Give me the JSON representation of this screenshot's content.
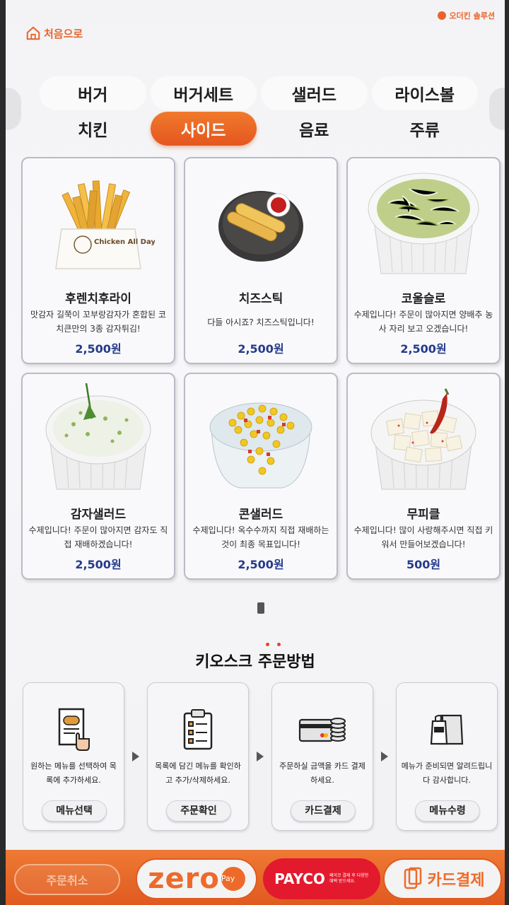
{
  "header": {
    "home_label": "처음으로",
    "brand": "오더킨 솔루션"
  },
  "categories": [
    {
      "label": "버거",
      "active": false
    },
    {
      "label": "버거세트",
      "active": false
    },
    {
      "label": "샐러드",
      "active": false
    },
    {
      "label": "라이스볼",
      "active": false
    },
    {
      "label": "치킨",
      "active": false
    },
    {
      "label": "사이드",
      "active": true
    },
    {
      "label": "음료",
      "active": false
    },
    {
      "label": "주류",
      "active": false
    }
  ],
  "menu": [
    {
      "name": "후렌치후라이",
      "desc": "맛감자 길쭉이 꼬부랑감자가 혼합된 코치큰만의 3종 감자튀김!",
      "price": "2,500원",
      "pic": "fries"
    },
    {
      "name": "치즈스틱",
      "desc": "다들 아시죠? 치즈스틱입니다!",
      "price": "2,500원",
      "pic": "cheese-stick"
    },
    {
      "name": "코울슬로",
      "desc": "수제입니다! 주문이 많아지면 양배추 농사 자리 보고 오겠습니다!",
      "price": "2,500원",
      "pic": "coleslaw"
    },
    {
      "name": "감자샐러드",
      "desc": "수제입니다! 주문이 많아지면 감자도 직접 재배하겠습니다!",
      "price": "2,500원",
      "pic": "potato-salad"
    },
    {
      "name": "콘샐러드",
      "desc": "수제입니다! 옥수수까지 직접 재배하는 것이 최종 목표입니다!",
      "price": "2,500원",
      "pic": "corn-salad"
    },
    {
      "name": "무피클",
      "desc": "수제입니다! 많이 사랑해주시면 직접 키워서 만들어보겠습니다!",
      "price": "500원",
      "pic": "radish-pickle"
    }
  ],
  "fries_bag_text": "Chicken All Day!",
  "guide": {
    "title": "키오스크 주문방법",
    "steps": [
      {
        "text": "원하는 메뉴를 선택하여 목록에 추가하세요.",
        "button": "메뉴선택",
        "icon": "menu-select-icon"
      },
      {
        "text": "목록에 담긴 메뉴를 확인하고 추가/삭제하세요.",
        "button": "주문확인",
        "icon": "clipboard-icon"
      },
      {
        "text": "주문하실 금액을 카드 결제하세요.",
        "button": "카드결제",
        "icon": "card-coins-icon"
      },
      {
        "text": "메뉴가 준비되면 알려드립니다 감사합니다.",
        "button": "메뉴수령",
        "icon": "takeout-bag-icon"
      }
    ]
  },
  "footer": {
    "cancel": "주문취소",
    "zero": "zero",
    "zero_pay": "Pay",
    "payco": "PAYCO",
    "payco_sub": "페이코 결제 후 다양한 혜택 받으세요.",
    "card": "카드결제"
  },
  "colors": {
    "accent": "#e8642a",
    "price": "#243a8c",
    "payco": "#e3192d"
  }
}
